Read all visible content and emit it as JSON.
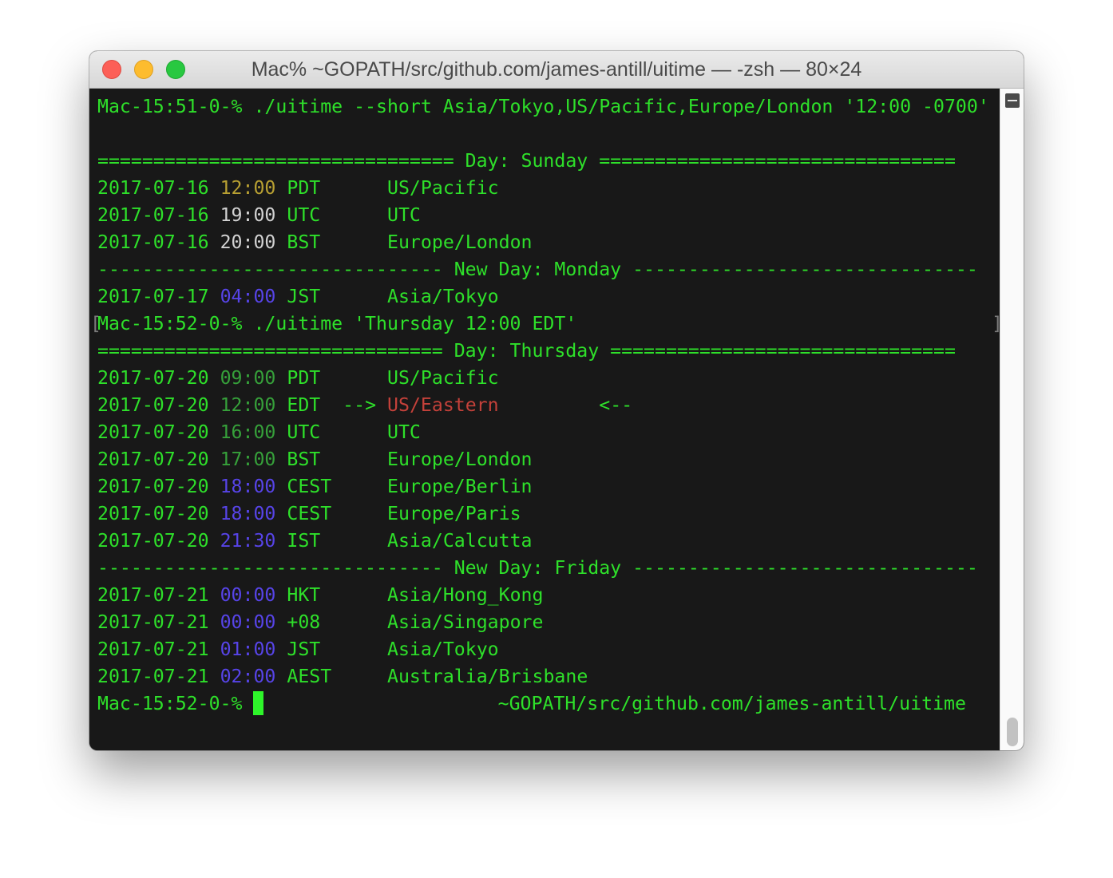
{
  "window": {
    "title": "Mac% ~GOPATH/src/github.com/james-antill/uitime — -zsh — 80×24"
  },
  "colors": {
    "background": "#181818",
    "text_green": "#2ee02a",
    "time_yellow": "#b8a032",
    "time_white": "#d2d2d2",
    "time_blue": "#5744e8",
    "time_darkgreen": "#36a03a",
    "highlight_red": "#c4413a"
  },
  "terminal": {
    "cmd1": "Mac-15:51-0-% ./uitime --short Asia/Tokyo,US/Pacific,Europe/London '12:00 -0700'",
    "blank": "",
    "day_sunday": "================================ Day: Sunday ================================",
    "out1": {
      "rows": [
        {
          "date": "2017-07-16",
          "time": "12:00",
          "zone": "PDT",
          "arrow_l": "",
          "name": "US/Pacific",
          "arrow_r": ""
        },
        {
          "date": "2017-07-16",
          "time": "19:00",
          "zone": "UTC",
          "arrow_l": "",
          "name": "UTC",
          "arrow_r": ""
        },
        {
          "date": "2017-07-16",
          "time": "20:00",
          "zone": "BST",
          "arrow_l": "",
          "name": "Europe/London",
          "arrow_r": ""
        }
      ]
    },
    "newday_monday": "------------------------------- New Day: Monday -------------------------------",
    "out2": {
      "rows": [
        {
          "date": "2017-07-17",
          "time": "04:00",
          "zone": "JST",
          "arrow_l": "",
          "name": "Asia/Tokyo",
          "arrow_r": ""
        }
      ]
    },
    "cmd2": "Mac-15:52-0-% ./uitime 'Thursday 12:00 EDT'",
    "bracket_open": "[",
    "bracket_close": "]",
    "day_thursday": "=============================== Day: Thursday ===============================",
    "out3": {
      "rows": [
        {
          "date": "2017-07-20",
          "time": "09:00",
          "zone": "PDT",
          "arrow_l": "",
          "name": "US/Pacific",
          "arrow_r": ""
        },
        {
          "date": "2017-07-20",
          "time": "12:00",
          "zone": "EDT",
          "arrow_l": "-->",
          "name": "US/Eastern",
          "arrow_r": "<--"
        },
        {
          "date": "2017-07-20",
          "time": "16:00",
          "zone": "UTC",
          "arrow_l": "",
          "name": "UTC",
          "arrow_r": ""
        },
        {
          "date": "2017-07-20",
          "time": "17:00",
          "zone": "BST",
          "arrow_l": "",
          "name": "Europe/London",
          "arrow_r": ""
        },
        {
          "date": "2017-07-20",
          "time": "18:00",
          "zone": "CEST",
          "arrow_l": "",
          "name": "Europe/Berlin",
          "arrow_r": ""
        },
        {
          "date": "2017-07-20",
          "time": "18:00",
          "zone": "CEST",
          "arrow_l": "",
          "name": "Europe/Paris",
          "arrow_r": ""
        },
        {
          "date": "2017-07-20",
          "time": "21:30",
          "zone": "IST",
          "arrow_l": "",
          "name": "Asia/Calcutta",
          "arrow_r": ""
        }
      ]
    },
    "newday_friday": "------------------------------- New Day: Friday -------------------------------",
    "out4": {
      "rows": [
        {
          "date": "2017-07-21",
          "time": "00:00",
          "zone": "HKT",
          "arrow_l": "",
          "name": "Asia/Hong_Kong",
          "arrow_r": ""
        },
        {
          "date": "2017-07-21",
          "time": "00:00",
          "zone": "+08",
          "arrow_l": "",
          "name": "Asia/Singapore",
          "arrow_r": ""
        },
        {
          "date": "2017-07-21",
          "time": "01:00",
          "zone": "JST",
          "arrow_l": "",
          "name": "Asia/Tokyo",
          "arrow_r": ""
        },
        {
          "date": "2017-07-21",
          "time": "02:00",
          "zone": "AEST",
          "arrow_l": "",
          "name": "Australia/Brisbane",
          "arrow_r": ""
        }
      ]
    },
    "prompt": "Mac-15:52-0-% ",
    "rprompt": "~GOPATH/src/github.com/james-antill/uitime"
  }
}
